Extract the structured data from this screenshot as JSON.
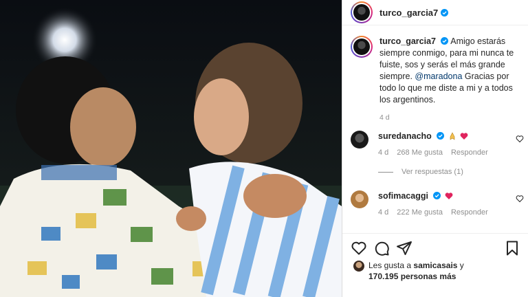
{
  "post": {
    "username": "turco_garcia7",
    "verified_icon": "verified-badge-icon",
    "caption_text": "Amigo estarás siempre conmigo, para mi nunca te fuiste, sos y serás el más grande siempre.",
    "caption_mention": "@maradona",
    "caption_tail": "Gracias por todo lo que me diste a mi y a todos los argentinos.",
    "time": "4 d"
  },
  "comments": [
    {
      "username": "suredanacho",
      "emoji": "pray-heart-emoji",
      "time": "4 d",
      "likes": "268 Me gusta",
      "reply": "Responder",
      "view_replies": "Ver respuestas (1)"
    },
    {
      "username": "sofimacaggi",
      "emoji": "heart-emoji",
      "time": "4 d",
      "likes": "222 Me gusta",
      "reply": "Responder"
    }
  ],
  "likes": {
    "prefix": "Les gusta a",
    "user": "samicasais",
    "suffix": "y",
    "count": "170.195 personas más"
  },
  "colors": {
    "accent": "#0095f6",
    "heart": "#ed4956",
    "mention": "#00376b"
  }
}
